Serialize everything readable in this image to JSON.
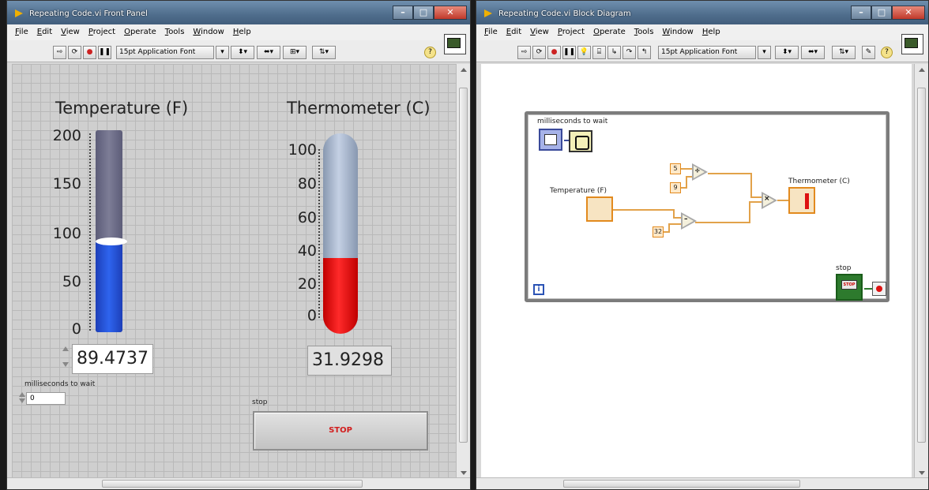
{
  "front_panel": {
    "title": "Repeating Code.vi Front Panel",
    "menu": [
      "File",
      "Edit",
      "View",
      "Project",
      "Operate",
      "Tools",
      "Window",
      "Help"
    ],
    "toolbar": {
      "font": "15pt Application Font"
    },
    "temperature": {
      "label": "Temperature (F)",
      "ticks": [
        "200",
        "150",
        "100",
        "50",
        "0"
      ],
      "value": "89.4737",
      "level": 89.4737,
      "max": 200,
      "fill_color": "#2e64ee"
    },
    "thermometer": {
      "label": "Thermometer (C)",
      "ticks": [
        "100",
        "80",
        "60",
        "40",
        "20",
        "0"
      ],
      "value": "31.9298",
      "level": 31.9298,
      "max": 110,
      "fill_color": "#ff2a2a"
    },
    "wait": {
      "label": "milliseconds to wait",
      "value": "0"
    },
    "stop": {
      "label": "stop",
      "button_text": "STOP"
    }
  },
  "block_diagram": {
    "title": "Repeating Code.vi Block Diagram",
    "menu": [
      "File",
      "Edit",
      "View",
      "Project",
      "Operate",
      "Tools",
      "Window",
      "Help"
    ],
    "toolbar": {
      "font": "15pt Application Font"
    },
    "labels": {
      "wait": "milliseconds to wait",
      "temperature": "Temperature (F)",
      "thermometer": "Thermometer (C)",
      "stop": "stop"
    },
    "constants": {
      "five": "5",
      "nine": "9",
      "thirty_two": "32"
    },
    "iteration": "i",
    "stop_text": "STOP"
  }
}
